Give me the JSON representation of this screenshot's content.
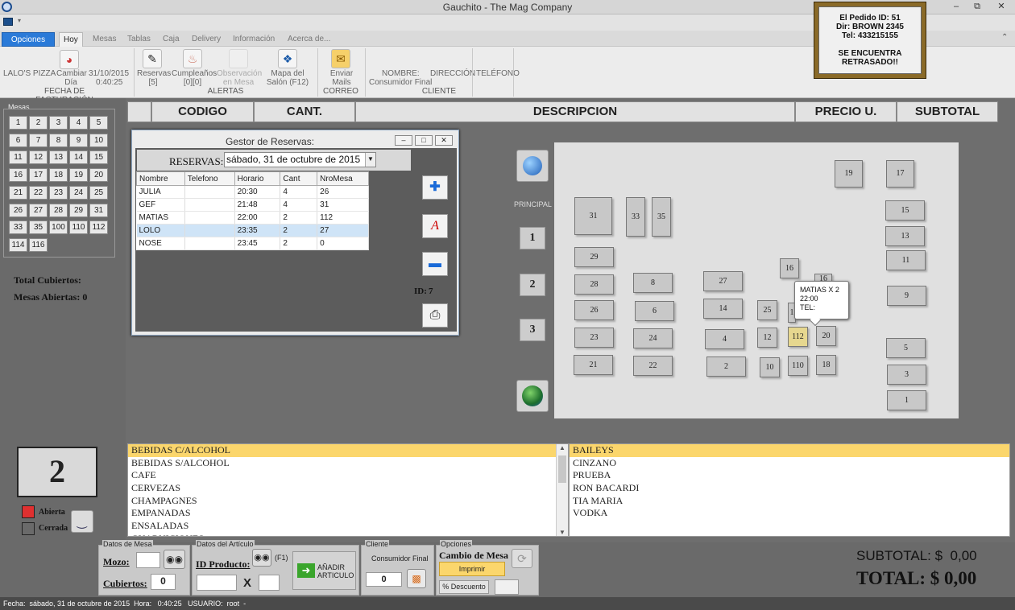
{
  "window": {
    "title": "Gauchito - The Mag Company"
  },
  "menu": {
    "tabs": [
      "Opciones",
      "Hoy",
      "Mesas",
      "Tablas",
      "Caja",
      "Delivery",
      "Información",
      "Acerca de..."
    ]
  },
  "ribbon": {
    "business": "LALO'S PIZZA",
    "cambiar_dia": "Cambiar Día",
    "date": "31/10/2015",
    "time": "0:40:25",
    "fecha_group": "FECHA DE FACTURACIÓN",
    "reservas": "Reservas [5]",
    "cumpleanos": "Cumpleaños [0][0]",
    "observacion": "Observación en Mesa",
    "mapa": "Mapa del Salón (F12)",
    "alertas_group": "ALERTAS",
    "enviar_mails": "Enviar Mails",
    "correo_group": "CORREO",
    "nombre_label": "NOMBRE:",
    "nombre_value": "Consumidor Final",
    "direccion_label": "DIRECCIÓN",
    "telefono_label": "TELÉFONO",
    "cliente_group": "CLIENTE"
  },
  "notification": {
    "line1": "El Pedido ID: 51",
    "line2": "Dir: BROWN 2345",
    "line3": "Tel: 433215155",
    "line4": "SE ENCUENTRA",
    "line5": "RETRASADO!!"
  },
  "mesas_panel": {
    "title": "Mesas",
    "numbers": [
      "1",
      "2",
      "3",
      "4",
      "5",
      "6",
      "7",
      "8",
      "9",
      "10",
      "11",
      "12",
      "13",
      "14",
      "15",
      "16",
      "17",
      "18",
      "19",
      "20",
      "21",
      "22",
      "23",
      "24",
      "25",
      "26",
      "27",
      "28",
      "29",
      "31",
      "33",
      "35",
      "100",
      "110",
      "112",
      "114",
      "116"
    ],
    "total_cubiertos": "Total Cubiertos:",
    "mesas_abiertas": "Mesas Abiertas: 0",
    "current_table": "2",
    "legend_abierta": "Abierta",
    "legend_cerrada": "Cerrada"
  },
  "order_header": {
    "codigo": "CODIGO",
    "cant": "CANT.",
    "descripcion": "DESCRIPCION",
    "precio": "PRECIO U.",
    "subtotal": "SUBTOTAL"
  },
  "reservas_dialog": {
    "title": "Gestor de Reservas:",
    "reservas_label": "RESERVAS:",
    "date_value": "sábado, 31 de octubre de 2015",
    "columns": [
      "Nombre",
      "Telefono",
      "Horario",
      "Cant",
      "NroMesa"
    ],
    "rows": [
      [
        "JULIA",
        "",
        "20:30",
        "4",
        "26"
      ],
      [
        "GEF",
        "",
        "21:48",
        "4",
        "31"
      ],
      [
        "MATIAS",
        "",
        "22:00",
        "2",
        "112"
      ],
      [
        "LOLO",
        "",
        "23:35",
        "2",
        "27"
      ],
      [
        "NOSE",
        "",
        "23:45",
        "2",
        "0"
      ]
    ],
    "selected_row": 3,
    "id_label": "ID:",
    "id_value": "7"
  },
  "floor": {
    "principal_label": "PRINCIPAL",
    "pages": [
      "1",
      "2",
      "3"
    ],
    "tables": [
      "19",
      "17",
      "31",
      "33",
      "35",
      "15",
      "13",
      "29",
      "16",
      "11",
      "28",
      "8",
      "27",
      "9",
      "26",
      "6",
      "14",
      "25",
      "7",
      "24",
      "4",
      "12",
      "112",
      "20",
      "23",
      "5",
      "21",
      "22",
      "2",
      "10",
      "110",
      "18",
      "3",
      "1",
      "1",
      "16"
    ],
    "tooltip": {
      "line1": "MATIAS X 2",
      "line2": "22:00",
      "line3": "TEL:"
    }
  },
  "categories": [
    "BEBIDAS C/ALCOHOL",
    "BEBIDAS S/ALCOHOL",
    "CAFE",
    "CERVEZAS",
    "CHAMPAGNES",
    "EMPANADAS",
    "ENSALADAS",
    "GUARNICIONES"
  ],
  "products": [
    "BAILEYS",
    "CINZANO",
    "PRUEBA",
    "RON BACARDI",
    "TIA MARIA",
    "VODKA"
  ],
  "bottom": {
    "datos_mesa": "Datos de Mesa",
    "mozo_label": "Mozo:",
    "cubiertos_label": "Cubiertos:",
    "cubiertos_value": "0",
    "datos_articulo": "Datos del Artículo",
    "id_producto": "ID Producto:",
    "f1": "(F1)",
    "x": "X",
    "anadir": "AÑADIR ARTICULO",
    "cliente_group": "Cliente",
    "consumidor_final": "Consumidor Final",
    "cliente_value": "0",
    "opciones_group": "Opciones",
    "cambio_mesa": "Cambio de Mesa",
    "imprimir": "Imprimir",
    "descuento": "% Descuento",
    "subtotal": "SUBTOTAL: $  0,00",
    "total": "TOTAL: $ 0,00"
  },
  "status": {
    "text": "Fecha:  sábado, 31 de octubre de 2015  Hora:   0:40:25   USUARIO:  root  -"
  },
  "colors": {
    "accent": "#2a7ad8",
    "selected_category": "#fbd66c",
    "selected_table": "#e6d78f",
    "abierta": "#e03030"
  }
}
